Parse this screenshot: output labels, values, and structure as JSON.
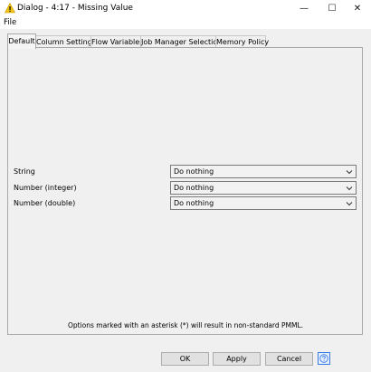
{
  "window": {
    "title": "Dialog - 4:17 - Missing Value",
    "minimize_glyph": "—",
    "maximize_glyph": "☐",
    "close_glyph": "✕",
    "title_icon": "warning-icon"
  },
  "menu": {
    "file": "File"
  },
  "tabs": [
    {
      "label": "Default",
      "active": true
    },
    {
      "label": "Column Settings",
      "active": false
    },
    {
      "label": "Flow Variables",
      "active": false
    },
    {
      "label": "Job Manager Selection",
      "active": false
    },
    {
      "label": "Memory Policy",
      "active": false
    }
  ],
  "settings": [
    {
      "label": "String",
      "value": "Do nothing"
    },
    {
      "label": "Number (integer)",
      "value": "Do nothing"
    },
    {
      "label": "Number (double)",
      "value": "Do nothing"
    }
  ],
  "note": "Options marked with an asterisk (*) will result in non-standard PMML.",
  "buttons": {
    "ok": "OK",
    "apply": "Apply",
    "cancel": "Cancel"
  },
  "help_icon": "help-icon",
  "colors": {
    "warning_icon": "#f3c417",
    "help_blue": "#3d7ae0",
    "panel_border": "#a8a8a8"
  }
}
